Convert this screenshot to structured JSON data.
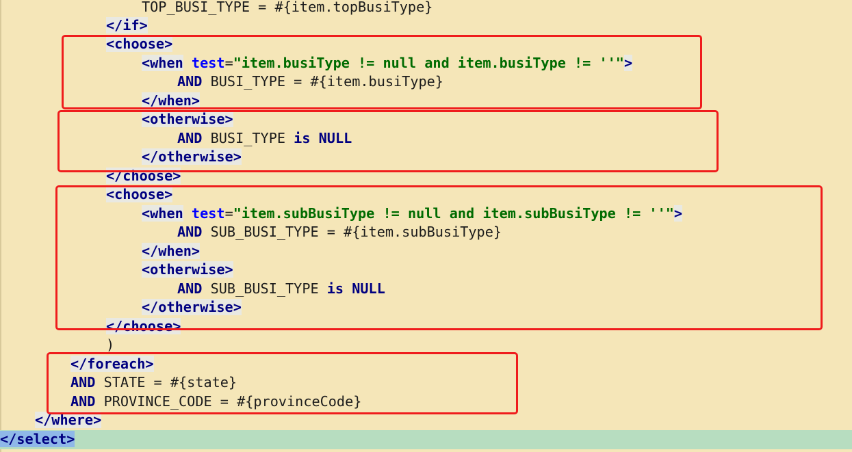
{
  "editor": {
    "lines": [
      {
        "text_parts": [
          {
            "t": "TOP_BUSI_TYPE = #{item.topBusiType}",
            "c": "text"
          }
        ]
      },
      {
        "text_parts": [
          {
            "t": "</if>",
            "c": "tag"
          }
        ]
      },
      {
        "text_parts": [
          {
            "t": "<choose>",
            "c": "tag"
          }
        ]
      },
      {
        "text_parts": [
          {
            "t": "<when",
            "c": "tag"
          },
          {
            "t": " test",
            "c": "attr"
          },
          {
            "t": "=",
            "c": "text"
          },
          {
            "t": "\"item.busiType != null and item.busiType != ''\"",
            "c": "str"
          },
          {
            "t": ">",
            "c": "tag"
          }
        ]
      },
      {
        "text_parts": [
          {
            "t": "AND",
            "c": "kw"
          },
          {
            "t": " BUSI_TYPE = #{item.busiType}",
            "c": "text"
          }
        ]
      },
      {
        "text_parts": [
          {
            "t": "</when>",
            "c": "tag"
          }
        ]
      },
      {
        "text_parts": [
          {
            "t": "<otherwise>",
            "c": "tag"
          }
        ]
      },
      {
        "text_parts": [
          {
            "t": "AND",
            "c": "kw"
          },
          {
            "t": " BUSI_TYPE ",
            "c": "text"
          },
          {
            "t": "is NULL",
            "c": "kw"
          }
        ]
      },
      {
        "text_parts": [
          {
            "t": "</otherwise>",
            "c": "tag"
          }
        ]
      },
      {
        "text_parts": [
          {
            "t": "</choose>",
            "c": "tag"
          }
        ]
      },
      {
        "text_parts": [
          {
            "t": "<choose>",
            "c": "tag"
          }
        ]
      },
      {
        "text_parts": [
          {
            "t": "<when",
            "c": "tag"
          },
          {
            "t": " test",
            "c": "attr"
          },
          {
            "t": "=",
            "c": "text"
          },
          {
            "t": "\"item.subBusiType != null and item.subBusiType != ''\"",
            "c": "str"
          },
          {
            "t": ">",
            "c": "tag"
          }
        ]
      },
      {
        "text_parts": [
          {
            "t": "AND",
            "c": "kw"
          },
          {
            "t": " SUB_BUSI_TYPE = #{item.subBusiType}",
            "c": "text"
          }
        ]
      },
      {
        "text_parts": [
          {
            "t": "</when>",
            "c": "tag"
          }
        ]
      },
      {
        "text_parts": [
          {
            "t": "<otherwise>",
            "c": "tag"
          }
        ]
      },
      {
        "text_parts": [
          {
            "t": "AND",
            "c": "kw"
          },
          {
            "t": " SUB_BUSI_TYPE ",
            "c": "text"
          },
          {
            "t": "is NULL",
            "c": "kw"
          }
        ]
      },
      {
        "text_parts": [
          {
            "t": "</otherwise>",
            "c": "tag"
          }
        ]
      },
      {
        "text_parts": [
          {
            "t": "</choose>",
            "c": "tag"
          }
        ]
      },
      {
        "text_parts": [
          {
            "t": ")",
            "c": "text"
          }
        ]
      },
      {
        "text_parts": [
          {
            "t": "</foreach>",
            "c": "tag"
          }
        ]
      },
      {
        "text_parts": [
          {
            "t": "AND",
            "c": "kw"
          },
          {
            "t": " STATE = #{state}",
            "c": "text"
          }
        ]
      },
      {
        "text_parts": [
          {
            "t": "AND",
            "c": "kw"
          },
          {
            "t": " PROVINCE_CODE = #{provinceCode}",
            "c": "text"
          }
        ]
      },
      {
        "text_parts": [
          {
            "t": "</where>",
            "c": "tag"
          }
        ]
      },
      {
        "text_parts": [
          {
            "t": "</select>",
            "c": "sel"
          }
        ]
      }
    ]
  },
  "colors": {
    "background": "#f5e6b8",
    "current_line": "#b7ddc0",
    "tag": "#000080",
    "attr": "#0000ff",
    "string": "#006b00",
    "highlight_box": "#ef1c1c"
  }
}
